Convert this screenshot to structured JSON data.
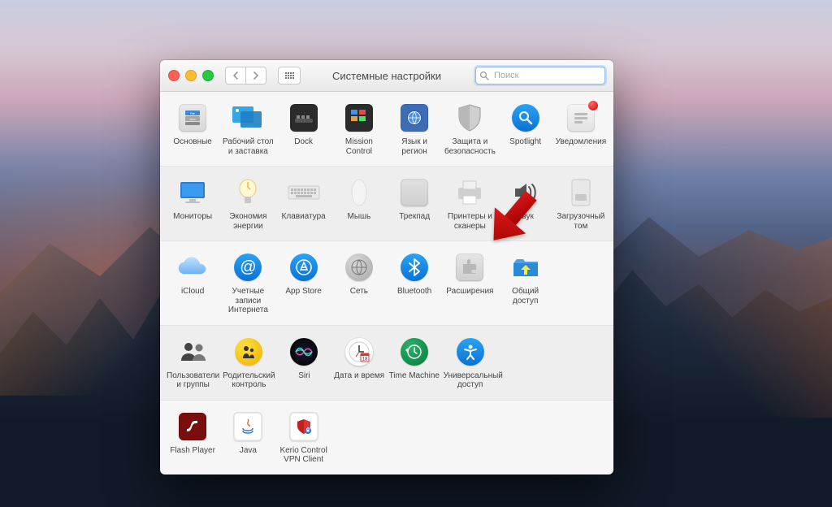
{
  "window": {
    "title": "Системные настройки",
    "search_placeholder": "Поиск"
  },
  "rows": [
    [
      {
        "id": "general",
        "label": "Основные"
      },
      {
        "id": "desktop",
        "label": "Рабочий стол и заставка"
      },
      {
        "id": "dock",
        "label": "Dock"
      },
      {
        "id": "mission",
        "label": "Mission Control"
      },
      {
        "id": "language",
        "label": "Язык и регион"
      },
      {
        "id": "security",
        "label": "Защита и безопасность"
      },
      {
        "id": "spotlight",
        "label": "Spotlight"
      },
      {
        "id": "notifications",
        "label": "Уведомления",
        "badge": true
      }
    ],
    [
      {
        "id": "displays",
        "label": "Мониторы"
      },
      {
        "id": "energy",
        "label": "Экономия энергии"
      },
      {
        "id": "keyboard",
        "label": "Клавиатура"
      },
      {
        "id": "mouse",
        "label": "Мышь"
      },
      {
        "id": "trackpad",
        "label": "Трекпад"
      },
      {
        "id": "printers",
        "label": "Принтеры и сканеры"
      },
      {
        "id": "sound",
        "label": "Звук"
      },
      {
        "id": "startup",
        "label": "Загрузочный том"
      }
    ],
    [
      {
        "id": "icloud",
        "label": "iCloud"
      },
      {
        "id": "internet",
        "label": "Учетные записи Интернета"
      },
      {
        "id": "appstore",
        "label": "App Store"
      },
      {
        "id": "network",
        "label": "Сеть"
      },
      {
        "id": "bluetooth",
        "label": "Bluetooth"
      },
      {
        "id": "extensions",
        "label": "Расширения"
      },
      {
        "id": "sharing",
        "label": "Общий доступ"
      }
    ],
    [
      {
        "id": "users",
        "label": "Пользователи и группы"
      },
      {
        "id": "parental",
        "label": "Родительский контроль"
      },
      {
        "id": "siri",
        "label": "Siri"
      },
      {
        "id": "datetime",
        "label": "Дата и время"
      },
      {
        "id": "timemachine",
        "label": "Time Machine"
      },
      {
        "id": "accessibility",
        "label": "Универсальный доступ"
      }
    ],
    [
      {
        "id": "flash",
        "label": "Flash Player"
      },
      {
        "id": "java",
        "label": "Java"
      },
      {
        "id": "kerio",
        "label": "Kerio Control VPN Client"
      }
    ]
  ],
  "annotation": {
    "arrow_points_to": "extensions"
  }
}
